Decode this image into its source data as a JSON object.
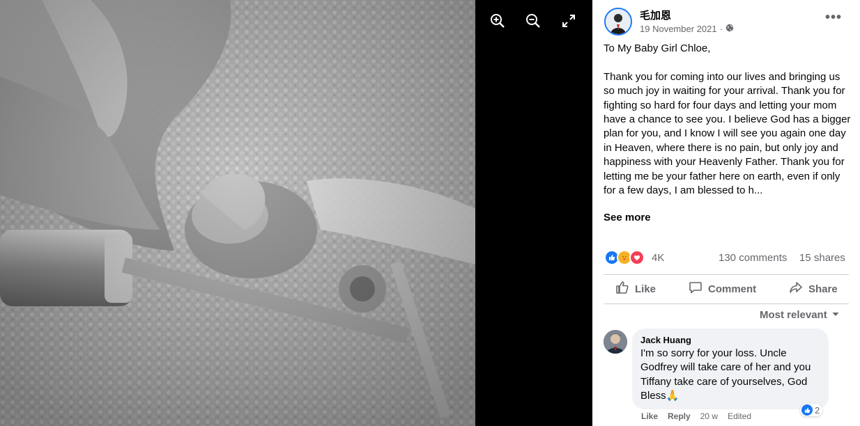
{
  "viewer": {
    "zoom_in_icon": "zoom-in-icon",
    "zoom_out_icon": "zoom-out-icon",
    "fullscreen_icon": "expand-icon"
  },
  "post": {
    "author": "毛加恩",
    "date": "19 November 2021",
    "separator": "·",
    "privacy_icon": "globe-icon",
    "greeting": "To My Baby Girl Chloe,",
    "body": "Thank you for coming into our lives and bringing us so much joy in waiting for your arrival. Thank you for fighting so hard for four days and letting your mom have a chance to see you. I believe God has a bigger plan for you, and I know I will see you again one day in Heaven, where there is no pain, but only joy and happiness with your Heavenly Father. Thank you for letting me be your father here on earth, even if only for a few days, I am blessed to h...",
    "see_more": "See more",
    "reactions_count": "4K",
    "comments_count": "130 comments",
    "shares_count": "15 shares",
    "accent": "#1877f2"
  },
  "actions": {
    "like": "Like",
    "comment": "Comment",
    "share": "Share"
  },
  "comments": {
    "sort_label": "Most relevant",
    "items": [
      {
        "name": "Jack Huang",
        "text": "I'm so sorry for your loss. Uncle Godfrey will take care of her and you Tiffany take care of yourselves, God Bless🙏",
        "likes": "2",
        "like_label": "Like",
        "reply_label": "Reply",
        "time": "20 w",
        "edited": "Edited"
      }
    ]
  }
}
